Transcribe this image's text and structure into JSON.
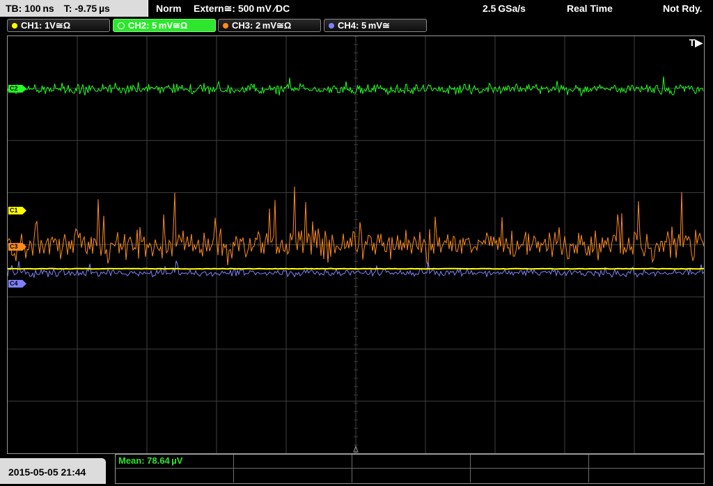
{
  "status_bar": {
    "timebase": "TB: 100 ns",
    "trigger_time": "T: -9.75 µs",
    "trigger_mode": "Norm",
    "trigger_source": "Extern≅: 500 mV ∕DC",
    "sample_rate": "2.5 GSa/s",
    "acquisition_mode": "Real Time",
    "ready_state": "Not Rdy."
  },
  "channels": [
    {
      "label": "CH1: 1V≅Ω",
      "color": "#ffff00",
      "marker": "C1",
      "active": false
    },
    {
      "label": "CH2: 5 mV≅Ω",
      "color": "#22ff22",
      "marker": "C2",
      "active": true
    },
    {
      "label": "CH3: 2 mV≅Ω",
      "color": "#ff8c1a",
      "marker": "C3",
      "active": false
    },
    {
      "label": "CH4: 5 mV≅",
      "color": "#8080ff",
      "marker": "C4",
      "active": false
    }
  ],
  "screen": {
    "trigger_indicator": "T▶",
    "grid_color": "#404040"
  },
  "bottom": {
    "datetime": "2015-05-05 21:44",
    "measurement": "Mean: 78.64 µV"
  }
}
